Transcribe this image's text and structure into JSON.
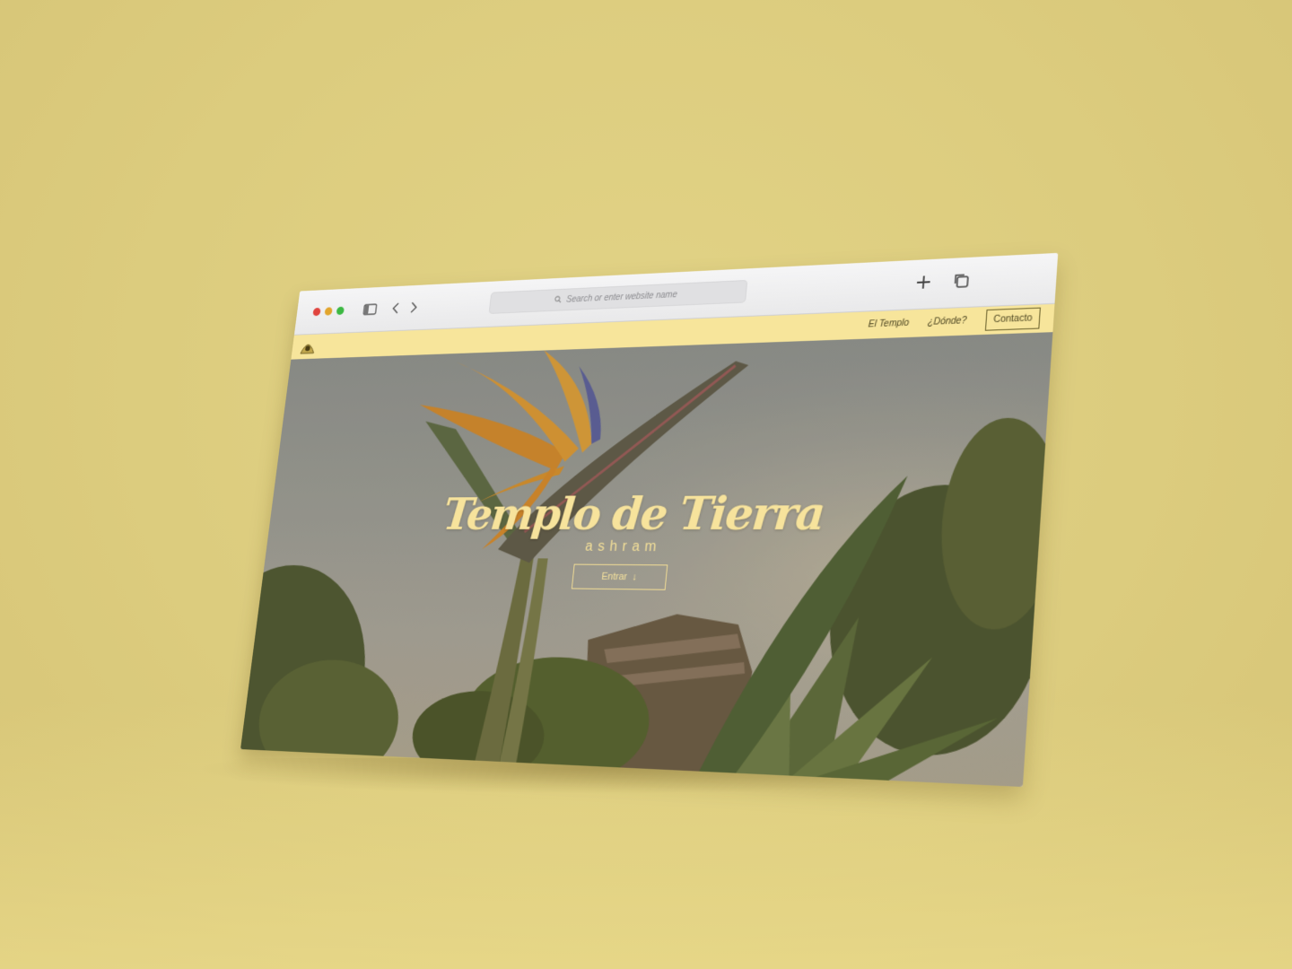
{
  "browser": {
    "address_placeholder": "Search or enter website name",
    "icons": [
      "sidebar-icon",
      "back-icon",
      "forward-icon",
      "search-icon",
      "new-tab-icon",
      "tabs-overview-icon"
    ]
  },
  "site": {
    "nav": {
      "links": [
        {
          "label": "El Templo"
        },
        {
          "label": "¿Dónde?"
        }
      ],
      "contact_label": "Contacto"
    },
    "hero": {
      "title": "Templo de Tierra",
      "subtitle": "ashram",
      "enter_label": "Entrar"
    }
  },
  "colors": {
    "background": "#dccc7e",
    "site_accent": "#f6e29a",
    "nav_text": "#4d4622"
  }
}
